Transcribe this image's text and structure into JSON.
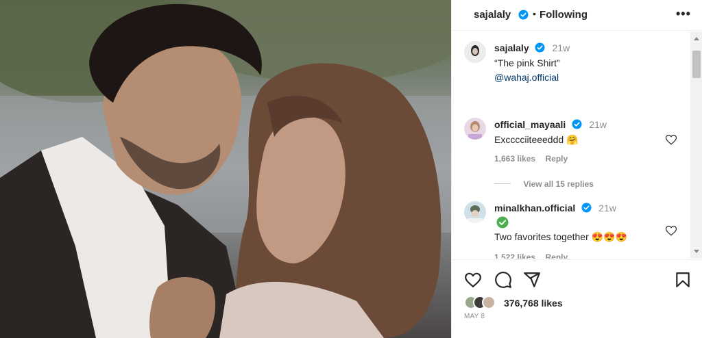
{
  "post": {
    "author": "sajalaly",
    "follow_label": "Following",
    "separator": "•",
    "more_label": "•••",
    "image_alt": "sajalaly post photo"
  },
  "caption": {
    "username": "sajalaly",
    "time": "21w",
    "line1": "“The pink Shirt”",
    "mention": "@wahaj.official"
  },
  "comments": [
    {
      "username": "official_mayaali",
      "time": "21w",
      "text": "Excccciiteeeddd 🤗",
      "likes": "1,663 likes",
      "reply": "Reply",
      "view_replies": "View all 15 replies"
    },
    {
      "username": "minalkhan.official",
      "time": "21w",
      "text": "Two favorites together 😍😍😍",
      "likes": "1,522 likes",
      "reply": "Reply"
    }
  ],
  "footer": {
    "likes_count": "376,768 likes",
    "date": "MAY 8"
  },
  "colors": {
    "verified": "#0095f6",
    "text": "#262626",
    "secondary": "#8e8e8e",
    "link": "#00376b",
    "green_check": "#4caf50"
  },
  "icons": [
    "verified-icon",
    "more-icon",
    "heart-icon",
    "comment-icon",
    "share-icon",
    "bookmark-icon",
    "green-check-icon"
  ]
}
